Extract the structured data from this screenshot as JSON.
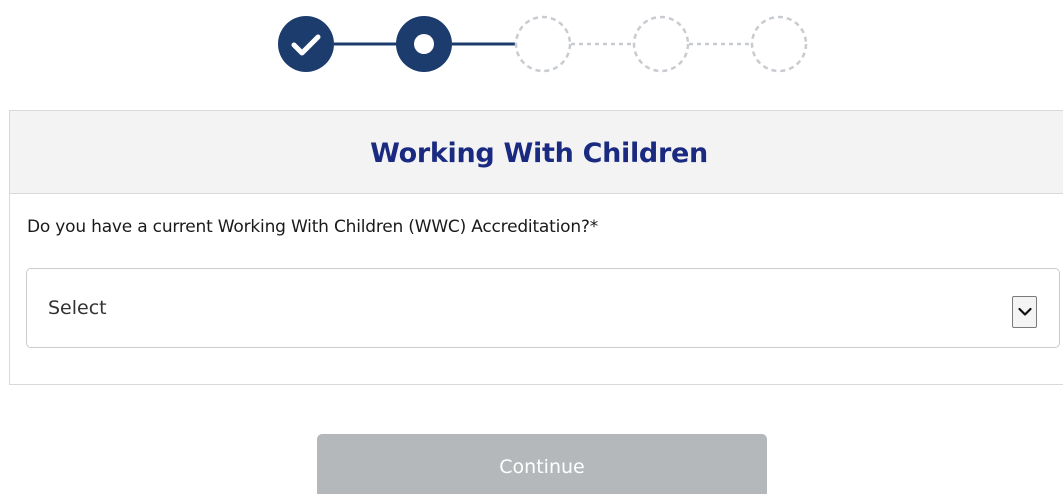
{
  "stepper": {
    "steps": [
      {
        "state": "completed",
        "icon": "check-icon"
      },
      {
        "state": "current",
        "icon": "dot-icon"
      },
      {
        "state": "pending",
        "icon": "empty-circle-icon"
      },
      {
        "state": "pending",
        "icon": "empty-circle-icon"
      },
      {
        "state": "pending",
        "icon": "empty-circle-icon"
      }
    ],
    "active_color": "#1d3c6e",
    "pending_color": "#c8ccd0"
  },
  "card": {
    "title": "Working With Children",
    "question": "Do you have a current Working With Children (WWC) Accreditation?*",
    "select": {
      "value": "Select",
      "arrow_icon": "chevron-down-icon"
    }
  },
  "actions": {
    "continue_label": "Continue",
    "continue_disabled": true
  },
  "colors": {
    "title": "#1a2a80",
    "button_disabled_bg": "#b4b8bb"
  }
}
